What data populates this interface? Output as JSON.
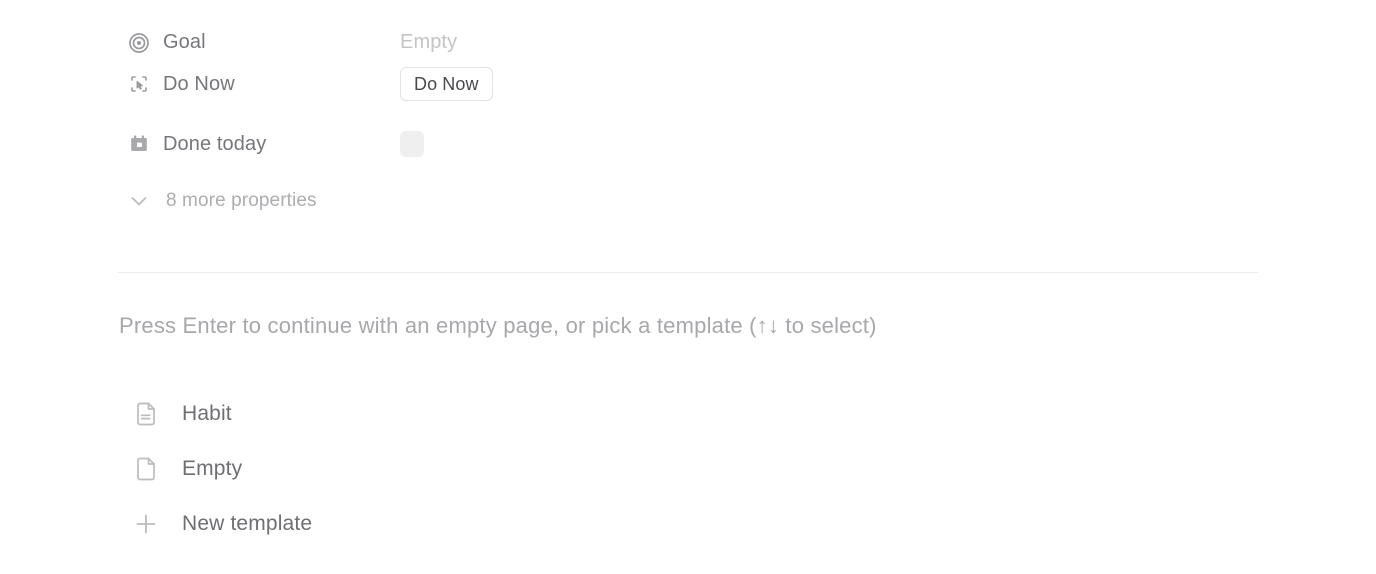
{
  "properties": {
    "rows": [
      {
        "icon": "target-icon",
        "label": "Goal",
        "value_type": "empty",
        "value": "Empty"
      },
      {
        "icon": "select-cursor-icon",
        "label": "Do Now",
        "value_type": "chip",
        "value": "Do Now"
      },
      {
        "icon": "calendar-filled-icon",
        "label": "Done today",
        "value_type": "checkbox",
        "value": ""
      }
    ],
    "more_properties": {
      "icon": "chevron-down-icon",
      "label": "8 more properties"
    }
  },
  "hint": {
    "text": "Press Enter to continue with an empty page, or pick a template (↑↓ to select)"
  },
  "templates": {
    "items": [
      {
        "icon": "document-lines-icon",
        "label": "Habit"
      },
      {
        "icon": "document-blank-icon",
        "label": "Empty"
      },
      {
        "icon": "plus-icon",
        "label": "New template"
      }
    ]
  },
  "colors": {
    "background": "#ffffff",
    "label_text": "#77767b",
    "placeholder_text": "#c4c3c6",
    "muted_text": "#a8a7ab",
    "icon": "#bcbbbe",
    "divider": "#ececed",
    "chip_border": "#e3e2e4",
    "checkbox_fill": "#f0efef"
  }
}
